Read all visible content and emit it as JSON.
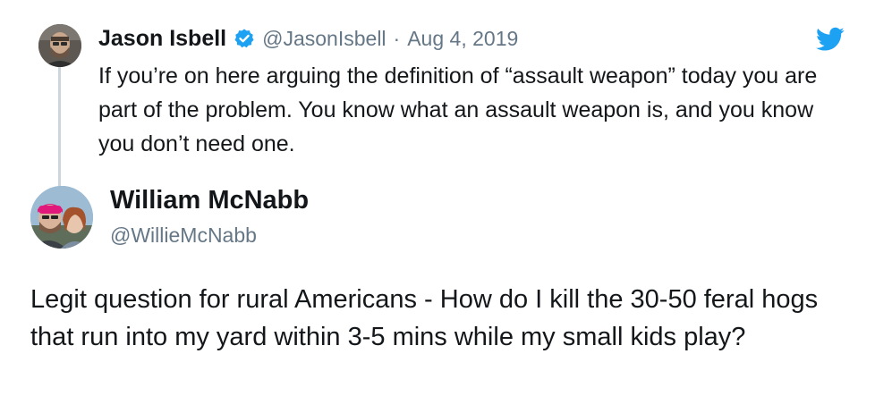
{
  "reply": {
    "author_name": "Jason Isbell",
    "handle": "@JasonIsbell",
    "separator": "·",
    "date": "Aug 4, 2019",
    "text": "If you’re on here arguing the definition of “assault weapon” today you are part of the problem. You know what an assault weapon is, and you know you don’t need one."
  },
  "quoted": {
    "author_name": "William McNabb",
    "handle": "@WillieMcNabb",
    "text": "Legit question for rural Americans - How do I kill the 30-50 feral hogs that run into my yard within 3-5 mins while my small kids play?"
  },
  "icons": {
    "verified": "verified-badge-icon",
    "brand": "twitter-bird-icon"
  },
  "colors": {
    "brand_blue": "#1da1f2",
    "text_primary": "#14171a",
    "text_secondary": "#657786",
    "thread_line": "#ccd6dd"
  }
}
